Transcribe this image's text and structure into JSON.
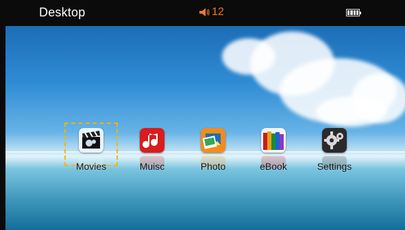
{
  "statusbar": {
    "title": "Desktop",
    "volume_icon": "speaker-icon",
    "volume_value": "12",
    "battery_icon": "battery-icon"
  },
  "desktop": {
    "selected_app": "Movies",
    "apps": [
      {
        "label": "Movies",
        "icon": "clapperboard-icon"
      },
      {
        "label": "Muisc",
        "icon": "music-note-icon"
      },
      {
        "label": "Photo",
        "icon": "photo-icon"
      },
      {
        "label": "eBook",
        "icon": "books-icon"
      },
      {
        "label": "Settings",
        "icon": "gears-icon"
      }
    ]
  },
  "colors": {
    "statusbar": "#0b0b0b",
    "volume": "#f07a2a",
    "selection": "#f5b400"
  }
}
